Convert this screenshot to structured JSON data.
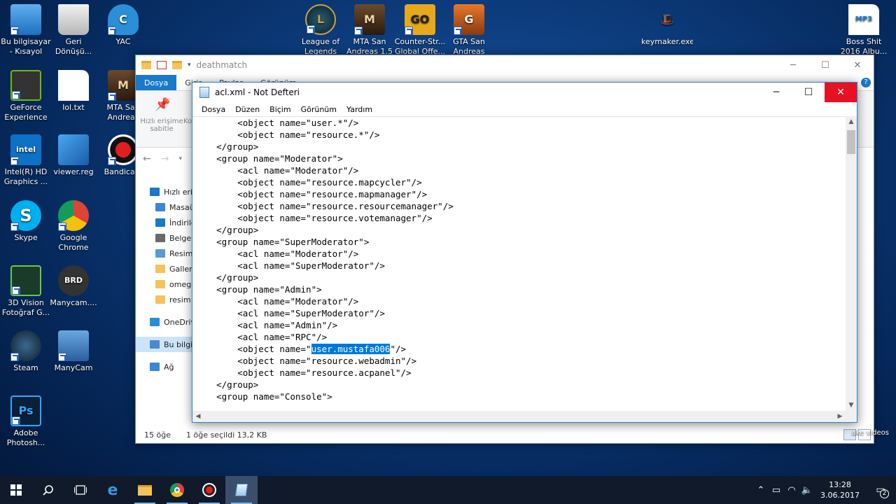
{
  "desktop": {
    "icons": [
      {
        "label": "Bu bilgisayar - Kısayol",
        "icon": "computer-icon"
      },
      {
        "label": "Geri Dönüşü...",
        "icon": "recycle-bin-icon"
      },
      {
        "label": "YAC",
        "icon": "yac-icon"
      },
      {
        "label": "League of Legends",
        "icon": "league-of-legends-icon"
      },
      {
        "label": "MTA San Andreas 1.5",
        "icon": "mta-icon"
      },
      {
        "label": "Counter-Str... Global Offe...",
        "icon": "csgo-icon"
      },
      {
        "label": "GTA San Andreas",
        "icon": "gta-icon"
      },
      {
        "label": "keymaker.exe",
        "icon": "keymaker-icon"
      },
      {
        "label": "Boss Shit 2016 Albu...",
        "icon": "mp3-file-icon"
      },
      {
        "label": "GeForce Experience",
        "icon": "geforce-icon"
      },
      {
        "label": "lol.txt",
        "icon": "text-file-icon"
      },
      {
        "label": "MTA San Andreas",
        "icon": "mta-icon"
      },
      {
        "label": "Intel(R) HD Graphics ...",
        "icon": "intel-icon"
      },
      {
        "label": "viewer.reg",
        "icon": "registry-file-icon"
      },
      {
        "label": "Bandicam",
        "icon": "bandicam-icon"
      },
      {
        "label": "Skype",
        "icon": "skype-icon"
      },
      {
        "label": "Google Chrome",
        "icon": "chrome-icon"
      },
      {
        "label": "3D Vision Fotoğraf G...",
        "icon": "3d-vision-icon"
      },
      {
        "label": "Manycam....",
        "icon": "manycam-file-icon"
      },
      {
        "label": "Steam",
        "icon": "steam-icon"
      },
      {
        "label": "ManyCam",
        "icon": "manycam-icon"
      },
      {
        "label": "Adobe Photosh...",
        "icon": "photoshop-icon"
      }
    ],
    "partial_label": "ake videos"
  },
  "explorer": {
    "title": "deathmatch",
    "ribbon_tabs": [
      "Dosya",
      "Giriş",
      "Paylaş",
      "Görünüm"
    ],
    "ribbon_button": "Hızlı erişime sabitle",
    "ribbon_button_partial": "Ko",
    "nav_items": [
      "Hızlı erişim",
      "Masaüstü",
      "İndirilenler",
      "Belgeler",
      "Resimler",
      "Gallery",
      "omegle",
      "resim",
      "OneDrive",
      "Bu bilgisayar",
      "Ağ"
    ],
    "status_count": "15 öğe",
    "status_selected": "1 öğe seçildi  13,2 KB"
  },
  "notepad": {
    "title": "acl.xml - Not Defteri",
    "menu": [
      "Dosya",
      "Düzen",
      "Biçim",
      "Görünüm",
      "Yardım"
    ],
    "lines": [
      "        <object name=\"user.*\"/>",
      "        <object name=\"resource.*\"/>",
      "    </group>",
      "    <group name=\"Moderator\">",
      "        <acl name=\"Moderator\"/>",
      "        <object name=\"resource.mapcycler\"/>",
      "        <object name=\"resource.mapmanager\"/>",
      "        <object name=\"resource.resourcemanager\"/>",
      "        <object name=\"resource.votemanager\"/>",
      "    </group>",
      "    <group name=\"SuperModerator\">",
      "        <acl name=\"Moderator\"/>",
      "        <acl name=\"SuperModerator\"/>",
      "    </group>",
      "    <group name=\"Admin\">",
      "        <acl name=\"Moderator\"/>",
      "        <acl name=\"SuperModerator\"/>",
      "        <acl name=\"Admin\"/>",
      "        <acl name=\"RPC\"/>",
      "        <object name=\"",
      "        <object name=\"resource.webadmin\"/>",
      "        <object name=\"resource.acpanel\"/>",
      "    </group>",
      "    <group name=\"Console\">"
    ],
    "selected_line": {
      "before": "        <object name=\"",
      "selected": "user.mustafa006",
      "after": "\"/>"
    }
  },
  "taskbar": {
    "time": "13:28",
    "date": "3.06.2017",
    "notification_count": "2"
  }
}
